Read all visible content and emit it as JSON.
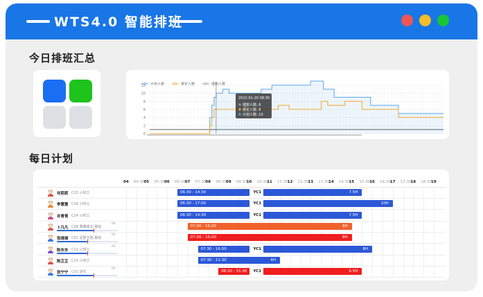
{
  "app": {
    "title": "WTS4.0 智能排班",
    "colors": {
      "titlebar": "#1976e6",
      "dot_red": "#ee5656",
      "dot_yellow": "#f4bd27",
      "dot_green": "#19c636"
    }
  },
  "summary": {
    "title": "今日排班汇总",
    "tiles": [
      {
        "color": "#1a6ef2"
      },
      {
        "color": "#1ec31c"
      },
      {
        "color": "#dfe0e4"
      },
      {
        "color": "#dfe0e4"
      }
    ]
  },
  "chart_data": {
    "type": "line",
    "legend": [
      "计划人数",
      "排定人数",
      "理想人数"
    ],
    "series_colors": [
      "#5aa6e8",
      "#f0a830",
      "#9a9a9a"
    ],
    "yticks": [
      "0",
      "2",
      "4",
      "6",
      "8",
      "10",
      "12"
    ],
    "ylim": [
      0,
      12
    ],
    "grid": true,
    "tooltip": {
      "time": "2022-01-20 08:30",
      "lines": [
        "理想人数: 8",
        "排定人数: 8",
        "计划人数: 10"
      ]
    },
    "series": [
      {
        "name": "计划人数",
        "values": [
          0,
          0,
          0,
          0,
          0,
          0,
          0,
          0,
          0,
          0,
          0,
          0,
          0,
          0,
          0,
          0,
          0,
          0,
          0,
          0,
          0,
          0,
          0,
          0,
          0,
          0,
          0,
          0,
          4,
          7,
          9,
          10,
          10,
          10,
          11,
          11,
          11,
          10,
          10,
          10,
          10,
          10,
          10,
          10,
          10,
          10,
          10,
          10,
          10,
          10,
          10,
          10,
          11,
          11,
          11,
          11,
          11,
          12,
          12,
          12,
          12,
          12,
          12,
          12,
          12,
          12,
          12,
          12,
          12,
          12,
          12,
          12,
          12,
          12,
          12,
          13,
          13,
          13,
          13,
          13,
          13,
          11,
          11,
          11,
          11,
          11,
          9,
          9,
          9,
          9,
          9,
          9,
          9,
          9,
          9,
          9,
          9,
          9,
          9,
          9,
          9,
          9,
          9,
          7,
          7,
          7,
          7,
          7,
          7,
          7,
          7,
          7,
          7,
          7,
          7,
          7,
          5,
          5,
          5,
          5,
          5,
          5,
          5,
          5,
          5,
          5,
          5,
          5,
          5,
          5,
          5,
          5,
          5,
          5,
          5,
          5,
          5,
          5
        ]
      },
      {
        "name": "排定人数",
        "values": [
          0,
          0,
          0,
          0,
          0,
          0,
          0,
          0,
          0,
          0,
          0,
          0,
          0,
          0,
          0,
          0,
          0,
          0,
          0,
          0,
          0,
          0,
          0,
          0,
          0,
          0,
          0,
          0,
          2,
          4,
          6,
          6,
          6,
          6,
          6,
          6,
          6,
          6,
          6,
          6,
          6,
          6,
          6,
          6,
          6,
          6,
          6,
          6,
          6,
          6,
          6,
          6,
          6,
          6,
          6,
          6,
          6,
          6,
          6,
          6,
          7,
          7,
          7,
          7,
          7,
          6,
          6,
          6,
          6,
          6,
          6,
          6,
          6,
          6,
          6,
          6,
          6,
          6,
          6,
          6,
          8,
          8,
          8,
          7,
          7,
          7,
          7,
          7,
          7,
          7,
          7,
          8,
          8,
          8,
          8,
          8,
          8,
          8,
          8,
          6,
          6,
          6,
          6,
          6,
          6,
          6,
          6,
          6,
          6,
          6,
          6,
          6,
          6,
          6,
          6,
          6,
          4,
          4,
          4,
          4,
          4,
          4,
          4,
          4,
          4,
          4,
          4,
          4,
          4,
          4,
          4,
          4,
          4,
          4,
          4,
          4,
          4,
          4
        ]
      },
      {
        "name": "理想人数",
        "values": [
          1,
          1,
          1,
          1,
          1,
          1,
          1,
          1,
          1,
          1,
          1,
          1,
          1,
          1,
          1,
          1,
          1,
          1,
          1,
          1,
          1,
          1,
          1,
          1,
          1,
          1,
          1,
          1,
          1,
          1,
          1,
          1,
          1,
          1,
          1,
          1,
          1,
          1,
          1,
          1,
          1,
          1,
          1,
          1,
          1,
          1,
          1,
          1,
          1,
          1,
          1,
          1,
          1,
          1,
          1,
          1,
          1,
          1,
          1,
          1,
          1,
          1,
          1,
          1,
          1,
          1,
          1,
          1,
          1,
          1,
          1,
          1,
          1,
          1,
          1,
          1,
          1,
          1,
          1,
          1,
          1,
          1,
          1,
          1,
          1,
          1,
          1,
          1,
          1,
          1,
          1,
          1,
          1,
          1,
          1,
          1,
          1,
          1,
          1,
          1,
          1,
          1,
          1,
          1,
          1,
          1,
          1,
          1,
          1,
          1,
          1,
          1,
          1,
          1,
          1,
          1,
          1,
          1,
          1,
          1,
          1,
          1,
          1,
          1,
          1,
          1,
          1,
          1,
          1,
          1,
          1,
          1,
          1,
          1,
          1,
          1,
          1,
          1
        ]
      }
    ]
  },
  "daily": {
    "title": "每日计划",
    "hours": [
      "04",
      "04:30",
      "05",
      "05:30",
      "06",
      "06:30",
      "07",
      "07:30",
      "08",
      "08:30",
      "09",
      "09:30",
      "10",
      "10:30",
      "11",
      "11:30",
      "12",
      "12:30",
      "13",
      "13:30",
      "14",
      "14:30",
      "15",
      "15:30",
      "16",
      "16:30",
      "17",
      "17:30",
      "18",
      "18:30",
      "19"
    ],
    "rows": [
      {
        "name": "何莉莉",
        "role": "C15 小时工",
        "hours": "",
        "progress": 0,
        "avatar": "#d9534f",
        "bars": [
          {
            "start": 6.5,
            "end": 10.0,
            "label": "06:30 - 14:30",
            "hours": "",
            "color": "#2c58d8"
          },
          {
            "start": 10.7,
            "end": 15.5,
            "label": "",
            "hours": "7.5H",
            "color": "#2c58d8"
          }
        ],
        "yc": "YC1",
        "yc_at": 10.3
      },
      {
        "name": "李慧慧",
        "role": "C16 小时工",
        "hours": "",
        "progress": 0,
        "avatar": "#e08a3c",
        "bars": [
          {
            "start": 6.5,
            "end": 10.0,
            "label": "06:30 - 17:00",
            "hours": "",
            "color": "#2c58d8"
          },
          {
            "start": 10.7,
            "end": 17.0,
            "label": "",
            "hours": "10H",
            "color": "#2c58d8"
          }
        ],
        "yc": "YC1",
        "yc_at": 10.3
      },
      {
        "name": "许青青",
        "role": "C14 小时工",
        "hours": "",
        "progress": 0,
        "avatar": "#c94b8d",
        "bars": [
          {
            "start": 6.5,
            "end": 10.0,
            "label": "06:30 - 14:30",
            "hours": "",
            "color": "#2c58d8"
          },
          {
            "start": 10.7,
            "end": 15.5,
            "label": "",
            "hours": "7.5H",
            "color": "#2c58d8"
          }
        ],
        "yc": "YC1",
        "yc_at": 10.3
      },
      {
        "name": "卜凡凡",
        "role": "C08 果蔬组长-晨班",
        "hours": "0h",
        "progress": 0.6,
        "avatar": "#d9534f",
        "bars": [
          {
            "start": 7.0,
            "end": 15.0,
            "label": "07:00 - 15:00",
            "hours": "8H",
            "color": "#f0622a"
          }
        ],
        "yc": "",
        "yc_at": 0
      },
      {
        "name": "张琦琦",
        "role": "C02 总部主管-晨班",
        "hours": "0h",
        "progress": 0.5,
        "avatar": "#3c7ad9",
        "bars": [
          {
            "start": 7.0,
            "end": 15.0,
            "label": "07:00 - 15:00",
            "hours": "8H",
            "color": "#f01e1e"
          }
        ],
        "yc": "",
        "yc_at": 0
      },
      {
        "name": "陈东东",
        "role": "C11 小时工",
        "hours": "0h",
        "progress": 0.5,
        "avatar": "#7a4fc9",
        "bars": [
          {
            "start": 7.5,
            "end": 10.0,
            "label": "07:30 - 16:00",
            "hours": "",
            "color": "#2c58d8"
          },
          {
            "start": 10.7,
            "end": 16.0,
            "label": "",
            "hours": "8H",
            "color": "#2c58d8"
          }
        ],
        "yc": "YC1",
        "yc_at": 10.3
      },
      {
        "name": "陈芷芷",
        "role": "C10 小时工",
        "hours": "",
        "progress": 0,
        "avatar": "#d9534f",
        "bars": [
          {
            "start": 7.5,
            "end": 11.5,
            "label": "07:30 - 11:30",
            "hours": "4H",
            "color": "#2c58d8"
          }
        ],
        "yc": "",
        "yc_at": 0
      },
      {
        "name": "张宁宁",
        "role": "C01 店长",
        "hours": "0h",
        "progress": 0.6,
        "avatar": "#3c7ad9",
        "bars": [
          {
            "start": 8.5,
            "end": 10.0,
            "label": "08:30 - 15:30",
            "hours": "",
            "color": "#f01e1e"
          },
          {
            "start": 10.7,
            "end": 15.5,
            "label": "",
            "hours": "6.5H",
            "color": "#f01e1e"
          }
        ],
        "yc": "YC1",
        "yc_at": 10.3
      }
    ]
  }
}
